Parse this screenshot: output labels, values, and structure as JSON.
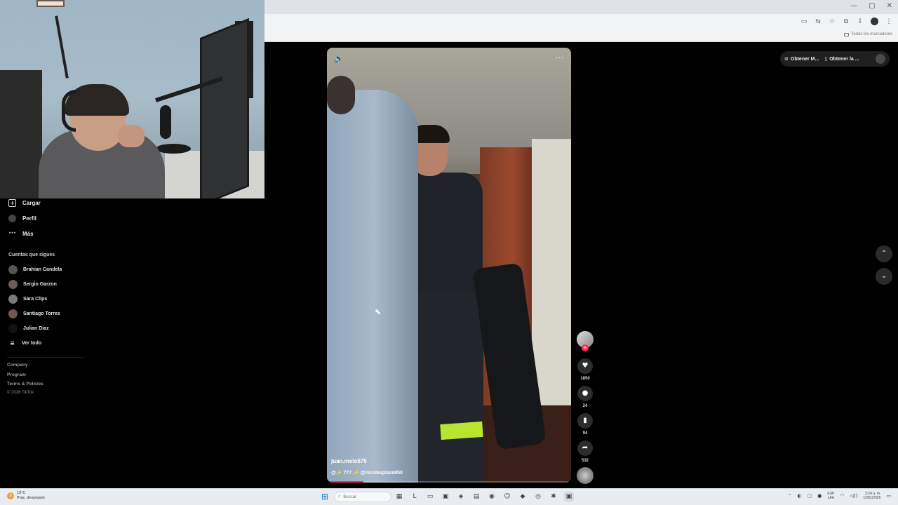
{
  "browser": {
    "window_controls": [
      "—",
      "▢",
      "✕"
    ],
    "toolbar_icons": [
      "cast-icon",
      "translate-icon",
      "star-icon",
      "extensions-icon"
    ],
    "bookmarks_folder": "Todos los marcadores"
  },
  "sidebar": {
    "nav": [
      {
        "label": "Cargar",
        "icon": "upload-icon"
      },
      {
        "label": "Perfil",
        "icon": "profile-avatar"
      },
      {
        "label": "Más",
        "icon": "more-icon"
      }
    ],
    "following_title": "Cuentas que sigues",
    "following": [
      "Brahian Candela",
      "Sergio Garzon",
      "Sara Clips",
      "Santiago Torres",
      "Julian Diaz"
    ],
    "see_all": "Ver todo",
    "footer_links": [
      "Company",
      "Program",
      "Terms & Policies"
    ],
    "copyright": "© 2026 TikTok"
  },
  "video": {
    "username": "juan.melo575",
    "caption": "@✨ 777 ✨ @nicolasplaza850",
    "progress": 0.15
  },
  "actions": {
    "likes": "1850",
    "comments": "24",
    "saves": "94",
    "shares": "532"
  },
  "top_actions": {
    "button1": "Obtener M...",
    "button2": "Obtener la ..."
  },
  "taskbar": {
    "temperature": "19°C",
    "weather_desc": "Prac. despejado",
    "search_placeholder": "Buscar",
    "lang_line1": "ESP",
    "lang_line2": "LAA",
    "time": "3:24 a. m.",
    "date": "12/01/2026",
    "notification_count": "3"
  },
  "colors": {
    "accent": "#fe2c55",
    "background": "#000000"
  }
}
